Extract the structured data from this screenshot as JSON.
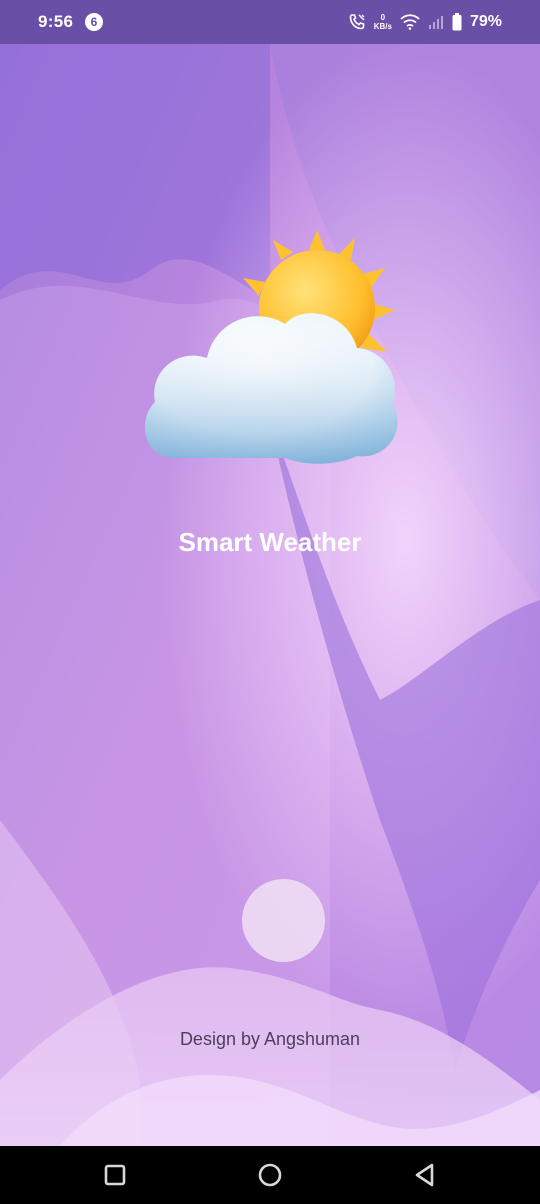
{
  "status_bar": {
    "time": "9:56",
    "notification_count": "6",
    "net_speed_value": "0",
    "net_speed_unit": "KB/s",
    "battery_percent": "79%",
    "icons": [
      "wifi-call-icon",
      "wifi-icon",
      "signal-icon",
      "battery-icon"
    ]
  },
  "splash": {
    "app_title": "Smart Weather",
    "credit": "Design by Angshuman",
    "logo_icon": "sun-behind-cloud-icon"
  },
  "nav_bar": {
    "icons": [
      "recent-apps-icon",
      "home-icon",
      "back-icon"
    ]
  },
  "colors": {
    "status_bar": "#6a4fa6",
    "background_primary": "#b98be0",
    "background_secondary": "#8e6bd8",
    "title_text": "#ffffff",
    "credit_text": "#4d3f5c"
  }
}
